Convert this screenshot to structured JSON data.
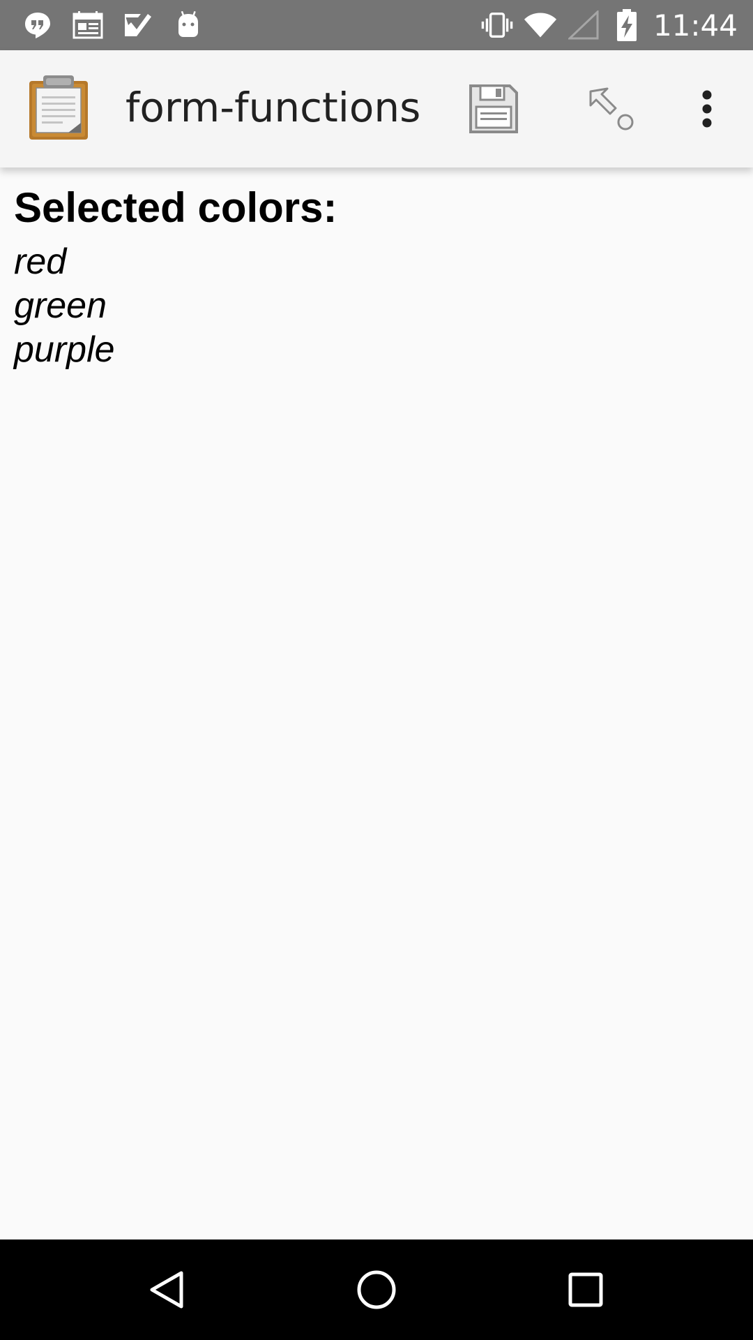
{
  "status_bar": {
    "time": "11:44",
    "left_icons": [
      "hangouts-icon",
      "calendar-icon",
      "tasks-icon",
      "android-icon"
    ],
    "right_icons": [
      "vibrate-icon",
      "wifi-icon",
      "cell-signal-icon",
      "battery-charging-icon"
    ]
  },
  "app_bar": {
    "title": "form-functions",
    "icon": "clipboard-icon",
    "actions": [
      "save-icon",
      "jump-icon",
      "more-vert-icon"
    ]
  },
  "content": {
    "heading": "Selected colors:",
    "colors": [
      "red",
      "green",
      "purple"
    ]
  },
  "nav_bar": {
    "buttons": [
      "back-icon",
      "home-icon",
      "recents-icon"
    ]
  },
  "colors": {
    "status_bar_bg": "#757575",
    "app_bar_bg": "#f5f5f5",
    "content_bg": "#fafafa",
    "nav_bar_bg": "#000000"
  }
}
